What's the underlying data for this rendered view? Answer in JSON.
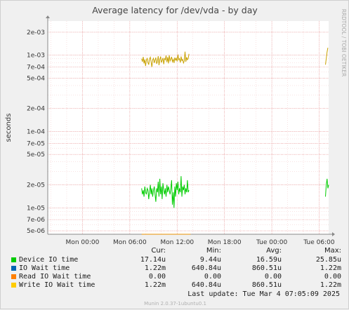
{
  "chart_data": {
    "type": "line",
    "title": "Average latency for /dev/vda - by day",
    "ylabel": "seconds",
    "watermark": "RRDTOOL / TOBI OETIKER",
    "y_scale": "log",
    "ylim": [
      4.5e-06,
      0.0028
    ],
    "y_ticks": [
      {
        "v": 0.002,
        "label": "2e-03"
      },
      {
        "v": 0.001,
        "label": "1e-03"
      },
      {
        "v": 0.0007,
        "label": "7e-04"
      },
      {
        "v": 0.0005,
        "label": "5e-04"
      },
      {
        "v": 0.0002,
        "label": "2e-04"
      },
      {
        "v": 0.0001,
        "label": "1e-04"
      },
      {
        "v": 7e-05,
        "label": "7e-05"
      },
      {
        "v": 5e-05,
        "label": "5e-05"
      },
      {
        "v": 2e-05,
        "label": "2e-05"
      },
      {
        "v": 1e-05,
        "label": "1e-05"
      },
      {
        "v": 7e-06,
        "label": "7e-06"
      },
      {
        "v": 5e-06,
        "label": "5e-06"
      }
    ],
    "x_ticks": [
      "Mon 00:00",
      "Mon 06:00",
      "Mon 12:00",
      "Mon 18:00",
      "Tue 00:00",
      "Tue 06:00"
    ],
    "x_range_hours": [
      -4.4,
      31.2
    ],
    "series": [
      {
        "name": "Write IO Wait time",
        "color": "#c8a200",
        "segments": [
          {
            "start_hour": 7.5,
            "step_hours": 0.1,
            "values": [
              0.0009,
              0.00082,
              0.00095,
              0.00078,
              0.00088,
              0.00072,
              0.00085,
              0.00092,
              0.0008,
              0.00075,
              0.00089,
              0.00094,
              0.00081,
              0.0007,
              0.00087,
              0.00091,
              0.00079,
              0.00086,
              0.00093,
              0.00077,
              0.00083,
              0.00097,
              0.00074,
              0.00088,
              0.00096,
              0.0008,
              0.00085,
              0.00092,
              0.00076,
              0.0009,
              0.00087,
              0.00099,
              0.00081,
              0.00094,
              0.00078,
              0.001,
              0.00084,
              0.00089,
              0.00095,
              0.00082,
              0.00088,
              0.00079,
              0.00093,
              0.00086,
              0.00091,
              0.00083,
              0.00102,
              0.00087,
              0.0009,
              0.0008,
              0.00096,
              0.00085,
              0.00088,
              0.00079,
              0.00084,
              0.00111,
              0.00082,
              0.00094,
              0.00087,
              0.0009,
              0.00104
            ]
          },
          {
            "start_hour": 30.8,
            "step_hours": 0.1,
            "values": [
              0.00075,
              0.0009,
              0.0011,
              0.00125
            ]
          }
        ]
      },
      {
        "name": "Device IO time",
        "color": "#00cc00",
        "segments": [
          {
            "start_hour": 7.5,
            "step_hours": 0.1,
            "values": [
              1.8e-05,
              1.5e-05,
              1.7e-05,
              1.4e-05,
              1.9e-05,
              1.6e-05,
              1.5e-05,
              1.8e-05,
              1.7e-05,
              1.3e-05,
              1.6e-05,
              2e-05,
              1.5e-05,
              1.8e-05,
              1.4e-05,
              1.7e-05,
              1.9e-05,
              1.5e-05,
              1.2e-05,
              1.8e-05,
              1.6e-05,
              2.2e-05,
              1.4e-05,
              2.4e-05,
              1.5e-05,
              1.9e-05,
              1.3e-05,
              2.1e-05,
              1.7e-05,
              1.5e-05,
              1.8e-05,
              1.4e-05,
              2e-05,
              1.6e-05,
              1.9e-05,
              1.7e-05,
              1.5e-05,
              1.8e-05,
              2.3e-05,
              1.1e-05,
              1.6e-05,
              1e-05,
              1.9e-05,
              1.4e-05,
              2.1e-05,
              1.7e-05,
              2.2e-05,
              1.5e-05,
              1.8e-05,
              1.6e-05,
              2.6e-05,
              1.4e-05,
              1.9e-05,
              1.7e-05,
              2e-05,
              1.5e-05,
              1.8e-05,
              1.6e-05,
              2.3e-05,
              1.6e-05,
              1.7e-05
            ]
          },
          {
            "start_hour": 30.8,
            "step_hours": 0.1,
            "values": [
              1.4e-05,
              2e-05,
              2.4e-05,
              1.8e-05,
              2e-05
            ]
          }
        ]
      },
      {
        "name": "Read IO Wait time",
        "color": "#ea8f00",
        "segments": [
          {
            "start_hour": 7.5,
            "step_hours": 6.2,
            "values": [
              4.5e-06,
              4.5e-06
            ]
          }
        ]
      }
    ],
    "legend": {
      "headers": [
        "Cur:",
        "Min:",
        "Avg:",
        "Max:"
      ],
      "rows": [
        {
          "label": "Device IO time",
          "color": "#00cc00",
          "cur": "17.14u",
          "min": "9.44u",
          "avg": "16.59u",
          "max": "25.85u"
        },
        {
          "label": "IO Wait time",
          "color": "#0066b3",
          "cur": "1.22m",
          "min": "640.84u",
          "avg": "860.51u",
          "max": "1.22m"
        },
        {
          "label": "Read IO Wait time",
          "color": "#ff8000",
          "cur": "0.00",
          "min": "0.00",
          "avg": "0.00",
          "max": "0.00"
        },
        {
          "label": "Write IO Wait time",
          "color": "#ffcc00",
          "cur": "1.22m",
          "min": "640.84u",
          "avg": "860.51u",
          "max": "1.22m"
        }
      ]
    },
    "last_update": "Last update:  Tue Mar  4 07:05:09 2025",
    "footer": "Munin 2.0.37-1ubuntu0.1"
  }
}
